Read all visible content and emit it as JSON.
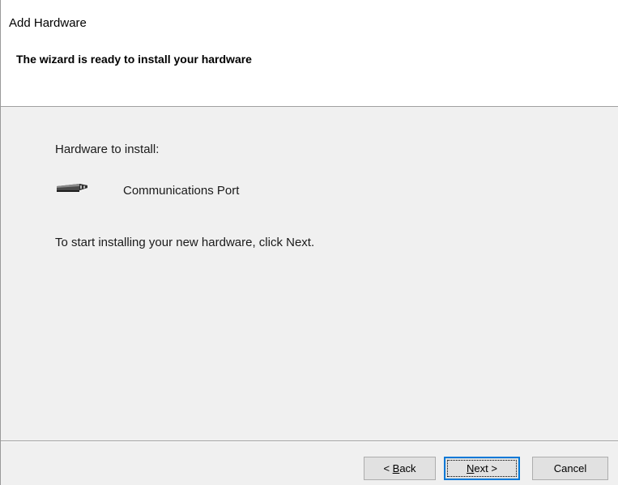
{
  "window": {
    "title": "Add Hardware"
  },
  "header": {
    "title": "The wizard is ready to install your hardware"
  },
  "content": {
    "hardware_label": "Hardware to install:",
    "device_name": "Communications Port",
    "device_icon": "serial-port-icon",
    "instruction": "To start installing your new hardware, click Next."
  },
  "buttons": {
    "back": {
      "prefix": "< ",
      "accel": "B",
      "rest": "ack"
    },
    "next": {
      "accel": "N",
      "rest": "ext >"
    },
    "cancel": {
      "label": "Cancel"
    }
  },
  "colors": {
    "dialog_bg": "#f0f0f0",
    "header_bg": "#ffffff",
    "focus_border": "#0078d7"
  }
}
